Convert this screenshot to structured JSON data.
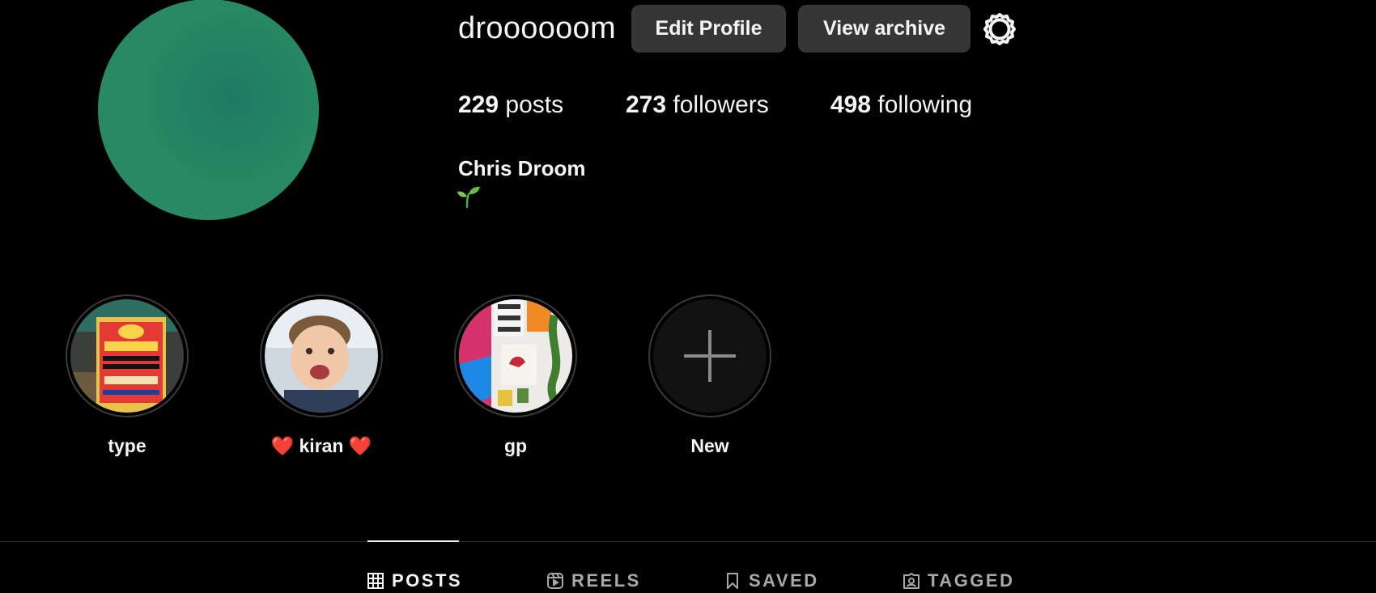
{
  "profile": {
    "username": "droooooom",
    "full_name": "Chris Droom",
    "bio_emoji": "seedling-icon",
    "avatar_color": "#268a66"
  },
  "actions": {
    "edit_profile": "Edit Profile",
    "view_archive": "View archive",
    "settings_icon": "gear-icon"
  },
  "stats": {
    "posts_count": "229",
    "posts_label": " posts",
    "followers_count": "273",
    "followers_label": " followers",
    "following_count": "498",
    "following_label": " following"
  },
  "highlights": [
    {
      "label": "type",
      "thumb": "cooking-oil-box-image"
    },
    {
      "label": "❤️ kiran ❤️",
      "thumb": "smiling-baby-image"
    },
    {
      "label": "gp",
      "thumb": "colorful-prints-wall-image"
    },
    {
      "label": "New",
      "thumb": "plus-icon"
    }
  ],
  "tabs": [
    {
      "label": "POSTS",
      "icon": "grid-icon",
      "active": true
    },
    {
      "label": "REELS",
      "icon": "reels-icon",
      "active": false
    },
    {
      "label": "SAVED",
      "icon": "bookmark-icon",
      "active": false
    },
    {
      "label": "TAGGED",
      "icon": "tagged-icon",
      "active": false
    }
  ],
  "colors": {
    "background": "#000000",
    "button_bg": "#363636",
    "text_primary": "#f5f5f5",
    "text_secondary": "#a8a8a8"
  }
}
